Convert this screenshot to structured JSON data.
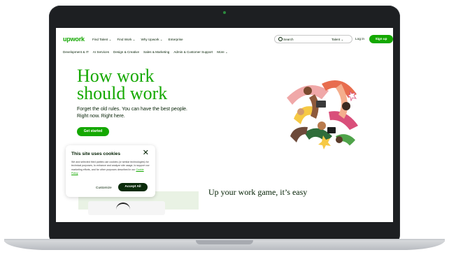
{
  "nav": {
    "logo": "upwork",
    "links": [
      "Find Talent ⌄",
      "Find Work ⌄",
      "Why Upwork ⌄",
      "Enterprise"
    ],
    "search_placeholder": "Search",
    "search_scope": "Talent ⌄",
    "login": "Log in",
    "signup": "Sign up"
  },
  "categories": [
    "Development & IT",
    "AI Services",
    "Design & Creative",
    "Sales & Marketing",
    "Admin & Customer Support",
    "More ⌄"
  ],
  "hero": {
    "title_line1": "How work",
    "title_line2": "should work",
    "subtitle_line1": "Forget the old rules. You can have the best people.",
    "subtitle_line2": "Right now. Right here.",
    "cta": "Get started"
  },
  "cookie": {
    "title": "This site uses cookies",
    "body": "We and selected third parties use cookies (or similar technologies) for technical purposes, to enhance and analyze site usage, to support our marketing efforts, and for other purposes described in our",
    "policy_link": "Cookie Policy",
    "customize": "Customize",
    "accept": "Accept All"
  },
  "section": {
    "title": "Up your work game, it’s easy"
  },
  "colors": {
    "brand": "#14a800",
    "frame": "#1d1f22",
    "text": "#001e00"
  }
}
